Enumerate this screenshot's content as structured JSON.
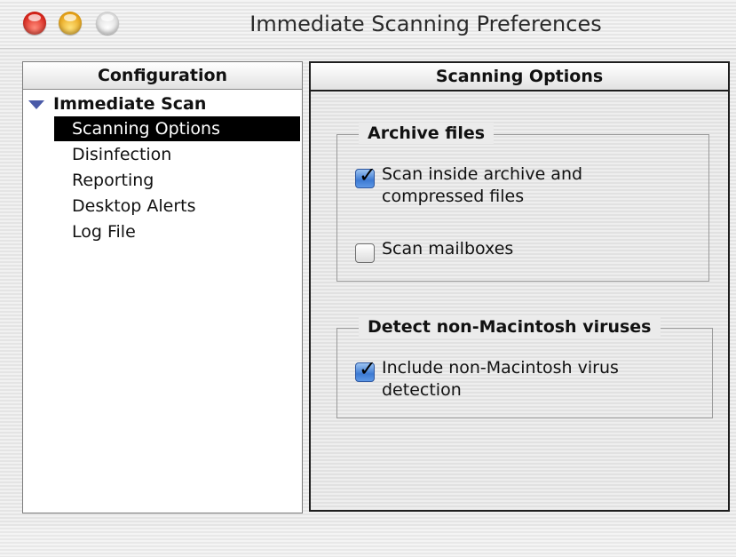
{
  "window": {
    "title": "Immediate Scanning Preferences",
    "controls": [
      "close",
      "minimize",
      "zoom"
    ]
  },
  "left": {
    "header": "Configuration",
    "root": "Immediate Scan",
    "items": [
      {
        "label": "Scanning Options",
        "selected": true
      },
      {
        "label": "Disinfection",
        "selected": false
      },
      {
        "label": "Reporting",
        "selected": false
      },
      {
        "label": "Desktop Alerts",
        "selected": false
      },
      {
        "label": "Log File",
        "selected": false
      }
    ]
  },
  "right": {
    "header": "Scanning Options",
    "groups": [
      {
        "title": "Archive files",
        "options": [
          {
            "label": "Scan inside archive and compressed files",
            "checked": true
          },
          {
            "label": "Scan mailboxes",
            "checked": false
          }
        ]
      },
      {
        "title": "Detect non-Macintosh viruses",
        "options": [
          {
            "label": "Include non-Macintosh virus detection",
            "checked": true
          }
        ]
      }
    ]
  },
  "colors": {
    "selection": "#000000",
    "checkbox_accent": "#3d7ad3",
    "disclosure_triangle": "#4a5aa8"
  },
  "icons": {
    "close": "close-icon",
    "minimize": "minimize-icon",
    "zoom": "zoom-icon",
    "disclosure": "disclosure-triangle-icon",
    "check": "checkmark-icon"
  }
}
